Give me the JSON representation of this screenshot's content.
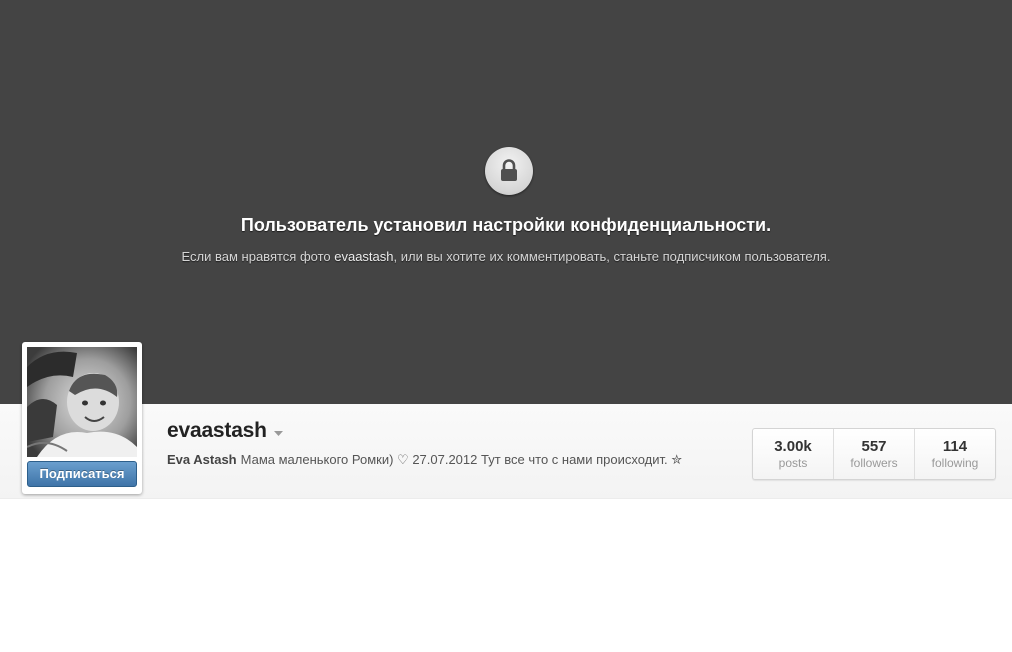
{
  "privacy": {
    "title": "Пользователь установил настройки конфиденциальности.",
    "subtitle_before": "Если вам нравятся фото ",
    "subtitle_username": "evaastash",
    "subtitle_after": ", или вы хотите их комментировать, станьте подписчиком пользователя.",
    "icon": "lock-icon"
  },
  "profile": {
    "username": "evaastash",
    "full_name": "Eva Astash",
    "bio": "Мама маленького Ромки) ♡ 27.07.2012 Тут все что с нами происходит. ✮",
    "follow_label": "Подписаться"
  },
  "stats": [
    {
      "value": "3.00k",
      "label": "posts"
    },
    {
      "value": "557",
      "label": "followers"
    },
    {
      "value": "114",
      "label": "following"
    }
  ],
  "colors": {
    "banner_bg": "#444444",
    "follow_button": "#4a7fb3"
  }
}
